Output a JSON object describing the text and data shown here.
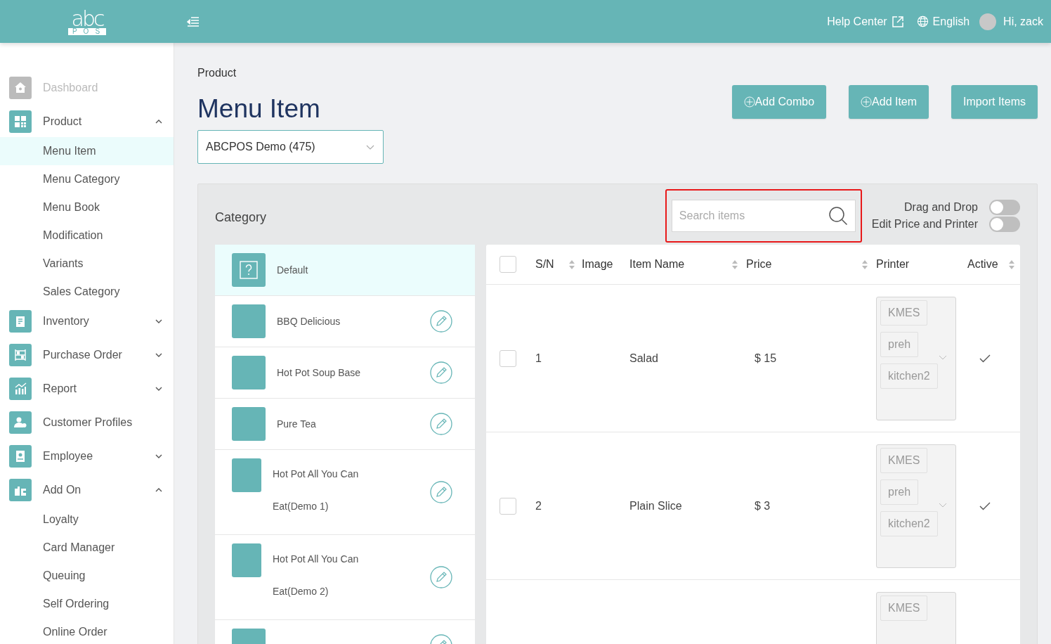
{
  "header": {
    "logo_top": "abc",
    "logo_bottom": "POS",
    "help": "Help Center",
    "language": "English",
    "greeting": "Hi, zack"
  },
  "sidebar": {
    "items": [
      {
        "label": "Dashboard",
        "disabled": true
      },
      {
        "label": "Product",
        "disabled": false,
        "expanded": true,
        "children": [
          {
            "label": "Menu Item",
            "selected": true
          },
          {
            "label": "Menu Category",
            "selected": false
          },
          {
            "label": "Menu Book",
            "selected": false
          },
          {
            "label": "Modification",
            "selected": false
          },
          {
            "label": "Variants",
            "selected": false
          },
          {
            "label": "Sales Category",
            "selected": false
          }
        ]
      },
      {
        "label": "Inventory",
        "disabled": false,
        "expanded": false
      },
      {
        "label": "Purchase Order",
        "disabled": false,
        "expanded": false
      },
      {
        "label": "Report",
        "disabled": false,
        "expanded": false
      },
      {
        "label": "Customer Profiles",
        "disabled": false
      },
      {
        "label": "Employee",
        "disabled": false,
        "expanded": false
      },
      {
        "label": "Add On",
        "disabled": false,
        "expanded": true,
        "children": [
          {
            "label": "Loyalty",
            "selected": false
          },
          {
            "label": "Card Manager",
            "selected": false
          },
          {
            "label": "Queuing",
            "selected": false
          },
          {
            "label": "Self Ordering",
            "selected": false
          },
          {
            "label": "Online Order",
            "selected": false
          }
        ]
      }
    ]
  },
  "breadcrumb": "Product",
  "title": "Menu Item",
  "buttons": [
    {
      "label": "Add Combo",
      "plus": true
    },
    {
      "label": "Add Item",
      "plus": true
    },
    {
      "label": "Import Items",
      "plus": false
    }
  ],
  "store_select": {
    "value": "ABCPOS Demo (475)"
  },
  "category_heading": "Category",
  "search": {
    "placeholder": "Search items",
    "highlighted": true
  },
  "toggles": [
    {
      "label": "Drag and Drop",
      "on": false
    },
    {
      "label": "Edit Price and Printer",
      "on": false
    }
  ],
  "categories": [
    {
      "name": "Default",
      "kind": "default",
      "selected": true
    },
    {
      "name": "BBQ Delicious",
      "kind": "normal",
      "selected": false
    },
    {
      "name": "Hot Pot Soup Base",
      "kind": "normal",
      "selected": false
    },
    {
      "name": "Pure Tea",
      "kind": "normal",
      "selected": false
    },
    {
      "name": "Hot Pot All You Can",
      "name_line2": "Eat(Demo 1)",
      "kind": "normal",
      "selected": false
    },
    {
      "name": "Hot Pot All You Can",
      "name_line2": "Eat(Demo 2)",
      "kind": "normal",
      "selected": false
    },
    {
      "kind": "normal",
      "selected": false
    }
  ],
  "table": {
    "columns": [
      {
        "label": "S/N",
        "sortable": true
      },
      {
        "label": "Image",
        "sortable": false
      },
      {
        "label": "Item Name",
        "sortable": true
      },
      {
        "label": "Price",
        "sortable": true
      },
      {
        "label": "Printer",
        "sortable": false
      },
      {
        "label": "Active",
        "sortable": true
      }
    ],
    "header_checked": false,
    "rows": [
      {
        "checked": false,
        "sn": "1",
        "name": "Salad",
        "price": "$ 15",
        "printers": [
          "KMES",
          "preh",
          "kitchen2"
        ],
        "active": true
      },
      {
        "checked": false,
        "sn": "2",
        "name": "Plain Slice",
        "price": "$ 3",
        "printers": [
          "KMES",
          "preh",
          "kitchen2"
        ],
        "active": true
      },
      {
        "printers": [
          "KMES"
        ]
      }
    ]
  }
}
